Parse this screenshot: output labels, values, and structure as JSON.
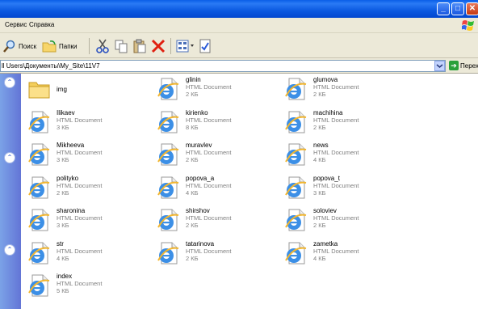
{
  "window": {
    "controls": [
      "minimize-button",
      "maximize-button",
      "close-button"
    ]
  },
  "menu": {
    "items": [
      "Сервис",
      "Справка"
    ]
  },
  "toolbar": {
    "search_label": "Поиск",
    "folders_label": "Папки"
  },
  "address": {
    "path": "ll Users\\Документы\\My_Site\\11V7",
    "go_label": "Переход"
  },
  "files": [
    {
      "name": "img",
      "type": "",
      "size": "",
      "kind": "folder"
    },
    {
      "name": "glinin",
      "type": "HTML Document",
      "size": "2 КБ",
      "kind": "html"
    },
    {
      "name": "glumova",
      "type": "HTML Document",
      "size": "2 КБ",
      "kind": "html"
    },
    {
      "name": "Ilikaev",
      "type": "HTML Document",
      "size": "3 КБ",
      "kind": "html"
    },
    {
      "name": "kirienko",
      "type": "HTML Document",
      "size": "8 КБ",
      "kind": "html"
    },
    {
      "name": "machihina",
      "type": "HTML Document",
      "size": "2 КБ",
      "kind": "html"
    },
    {
      "name": "Mikheeva",
      "type": "HTML Document",
      "size": "3 КБ",
      "kind": "html"
    },
    {
      "name": "muravlev",
      "type": "HTML Document",
      "size": "2 КБ",
      "kind": "html"
    },
    {
      "name": "news",
      "type": "HTML Document",
      "size": "4 КБ",
      "kind": "html"
    },
    {
      "name": "polityko",
      "type": "HTML Document",
      "size": "2 КБ",
      "kind": "html"
    },
    {
      "name": "popova_a",
      "type": "HTML Document",
      "size": "4 КБ",
      "kind": "html"
    },
    {
      "name": "popova_t",
      "type": "HTML Document",
      "size": "3 КБ",
      "kind": "html"
    },
    {
      "name": "sharonina",
      "type": "HTML Document",
      "size": "3 КБ",
      "kind": "html"
    },
    {
      "name": "shirshov",
      "type": "HTML Document",
      "size": "2 КБ",
      "kind": "html"
    },
    {
      "name": "soloviev",
      "type": "HTML Document",
      "size": "2 КБ",
      "kind": "html"
    },
    {
      "name": "str",
      "type": "HTML Document",
      "size": "4 КБ",
      "kind": "html"
    },
    {
      "name": "tatarinova",
      "type": "HTML Document",
      "size": "2 КБ",
      "kind": "html"
    },
    {
      "name": "zametka",
      "type": "HTML Document",
      "size": "4 КБ",
      "kind": "html"
    },
    {
      "name": "index",
      "type": "HTML Document",
      "size": "5 КБ",
      "kind": "html"
    }
  ]
}
